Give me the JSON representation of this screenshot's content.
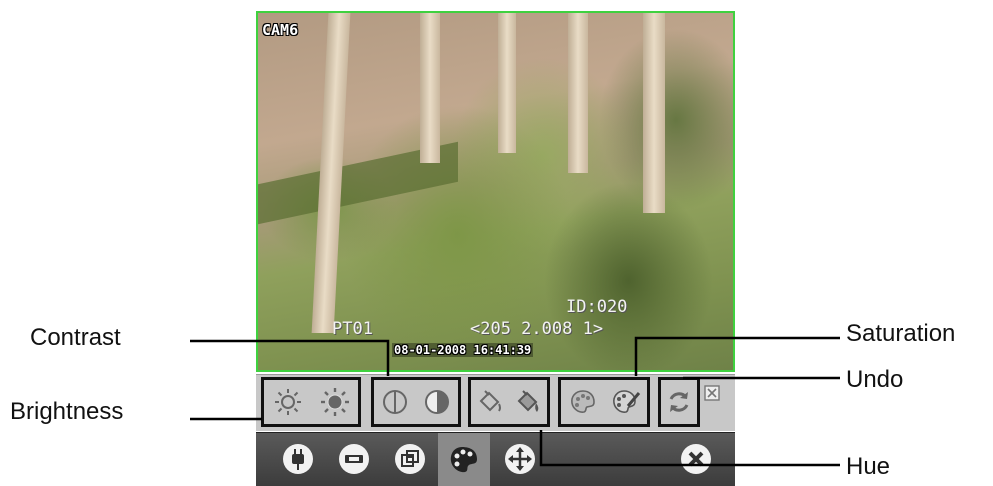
{
  "camera": {
    "label": "CAM6",
    "id_text": "ID:020",
    "ptz_text": "PT01",
    "position_text": "<205 2.008 1>",
    "timestamp": "08-01-2008 16:41:39",
    "border_color": "#3fd13f"
  },
  "adjust_toolbar": {
    "buttons": [
      {
        "name": "brightness-down",
        "icon": "sun-outline-icon"
      },
      {
        "name": "brightness-up",
        "icon": "sun-filled-icon"
      },
      {
        "name": "contrast-down",
        "icon": "circle-half-line-icon"
      },
      {
        "name": "contrast-up",
        "icon": "circle-half-filled-icon"
      },
      {
        "name": "hue-down",
        "icon": "paint-bucket-icon"
      },
      {
        "name": "hue-up",
        "icon": "paint-bucket-fill-icon"
      },
      {
        "name": "saturation-down",
        "icon": "palette-icon"
      },
      {
        "name": "saturation-up",
        "icon": "palette-brush-icon"
      },
      {
        "name": "undo",
        "icon": "refresh-arrows-icon"
      },
      {
        "name": "close-adjust",
        "icon": "close-box-icon"
      }
    ]
  },
  "main_toolbar": {
    "buttons": [
      {
        "name": "connect",
        "icon": "plug-icon"
      },
      {
        "name": "record",
        "icon": "tape-icon"
      },
      {
        "name": "multi-view",
        "icon": "overlap-windows-icon"
      },
      {
        "name": "color-adjust",
        "icon": "palette-icon",
        "active": true
      },
      {
        "name": "ptz-control",
        "icon": "move-arrows-icon"
      },
      {
        "name": "close",
        "icon": "close-circle-icon"
      }
    ]
  },
  "callouts": {
    "contrast": "Contrast",
    "brightness": "Brightness",
    "saturation": "Saturation",
    "undo": "Undo",
    "hue": "Hue"
  }
}
